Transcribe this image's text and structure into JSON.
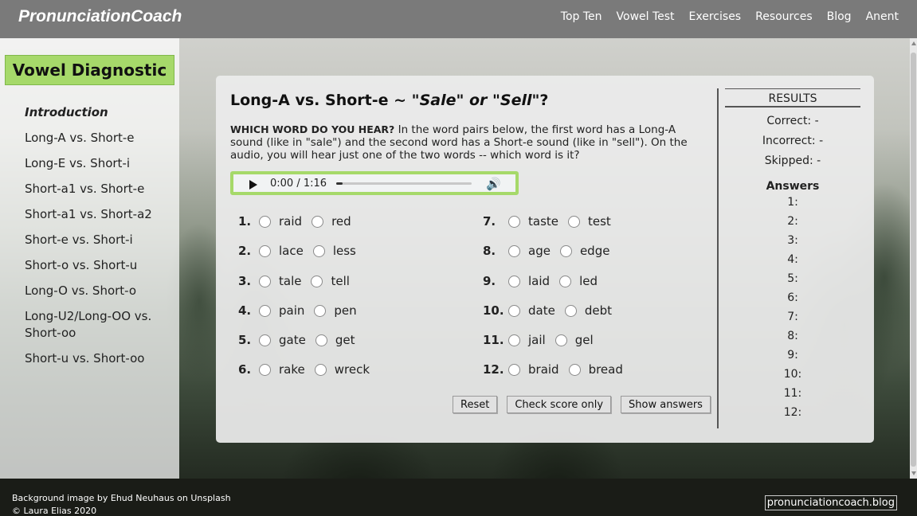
{
  "brand": "PronunciationCoach",
  "nav": [
    "Top Ten",
    "Vowel Test",
    "Exercises",
    "Resources",
    "Blog",
    "Anent"
  ],
  "sidebar": {
    "title": "Vowel Diagnostic",
    "items": [
      "Introduction",
      "Long-A vs. Short-e",
      "Long-E vs. Short-i",
      "Short-a1 vs. Short-e",
      "Short-a1 vs. Short-a2",
      "Short-e vs. Short-i",
      "Short-o vs. Short-u",
      "Long-O vs. Short-o",
      "Long-U2/Long-OO vs. Short-oo",
      "Short-u vs. Short-oo"
    ]
  },
  "main": {
    "title_plain": "Long-A vs. Short-e ~ ",
    "title_italic": "\"Sale\" or \"Sell\"",
    "title_end": "?",
    "instructions_bold": "WHICH WORD DO YOU HEAR?",
    "instructions_text": " In the word pairs below, the first word has a Long-A sound (like in \"sale\") and the second word has a Short-e sound (like in \"sell\"). On the audio, you will hear just one of the two words -- which word is it?",
    "audio_time": "0:00 / 1:16",
    "audio_progress": 0.0,
    "questions": [
      {
        "num": "1.",
        "a": "raid",
        "b": "red"
      },
      {
        "num": "2.",
        "a": "lace",
        "b": "less"
      },
      {
        "num": "3.",
        "a": "tale",
        "b": "tell"
      },
      {
        "num": "4.",
        "a": "pain",
        "b": "pen"
      },
      {
        "num": "5.",
        "a": "gate",
        "b": "get"
      },
      {
        "num": "6.",
        "a": "rake",
        "b": "wreck"
      },
      {
        "num": "7.",
        "a": "taste",
        "b": "test"
      },
      {
        "num": "8.",
        "a": "age",
        "b": "edge"
      },
      {
        "num": "9.",
        "a": "laid",
        "b": "led"
      },
      {
        "num": "10.",
        "a": "date",
        "b": "debt"
      },
      {
        "num": "11.",
        "a": "jail",
        "b": "gel"
      },
      {
        "num": "12.",
        "a": "braid",
        "b": "bread"
      }
    ],
    "buttons": {
      "reset": "Reset",
      "check": "Check score only",
      "show": "Show answers"
    }
  },
  "results": {
    "heading": "RESULTS",
    "correct": "Correct: -",
    "incorrect": "Incorrect: -",
    "skipped": "Skipped: -",
    "answers_title": "Answers",
    "answers": [
      "1:",
      "2:",
      "3:",
      "4:",
      "5:",
      "6:",
      "7:",
      "8:",
      "9:",
      "10:",
      "11:",
      "12:"
    ]
  },
  "footer": {
    "credit_line1": "Background image by Ehud Neuhaus on Unsplash",
    "credit_line2": "© Laura Elias 2020",
    "site_link": "pronunciationcoach.blog"
  },
  "colors": {
    "accent_green": "#a6d96a",
    "topbar": "#7a7a7a",
    "footer": "#1a1c17"
  }
}
